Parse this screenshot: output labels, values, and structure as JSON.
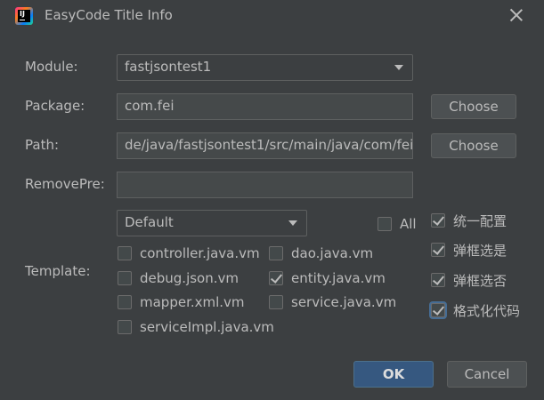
{
  "window": {
    "title": "EasyCode Title Info"
  },
  "form": {
    "module_label": "Module:",
    "module_value": "fastjsontest1",
    "package_label": "Package:",
    "package_value": "com.fei",
    "path_label": "Path:",
    "path_value": "de/java/fastjsontest1/src/main/java/com/fei",
    "removepre_label": "RemovePre:",
    "removepre_value": "",
    "template_label": "Template:",
    "template_group": "Default",
    "choose_label": "Choose"
  },
  "templates": {
    "all_label": "All",
    "all_checked": false,
    "items": [
      {
        "label": "controller.java.vm",
        "checked": false
      },
      {
        "label": "dao.java.vm",
        "checked": false
      },
      {
        "label": "debug.json.vm",
        "checked": false
      },
      {
        "label": "entity.java.vm",
        "checked": true
      },
      {
        "label": "mapper.xml.vm",
        "checked": false
      },
      {
        "label": "service.java.vm",
        "checked": false
      },
      {
        "label": "serviceImpl.java.vm",
        "checked": false
      }
    ]
  },
  "options": [
    {
      "label": "统一配置",
      "checked": true
    },
    {
      "label": "弹框选是",
      "checked": true
    },
    {
      "label": "弹框选否",
      "checked": true
    },
    {
      "label": "格式化代码",
      "checked": true
    }
  ],
  "footer": {
    "ok_label": "OK",
    "cancel_label": "Cancel"
  }
}
